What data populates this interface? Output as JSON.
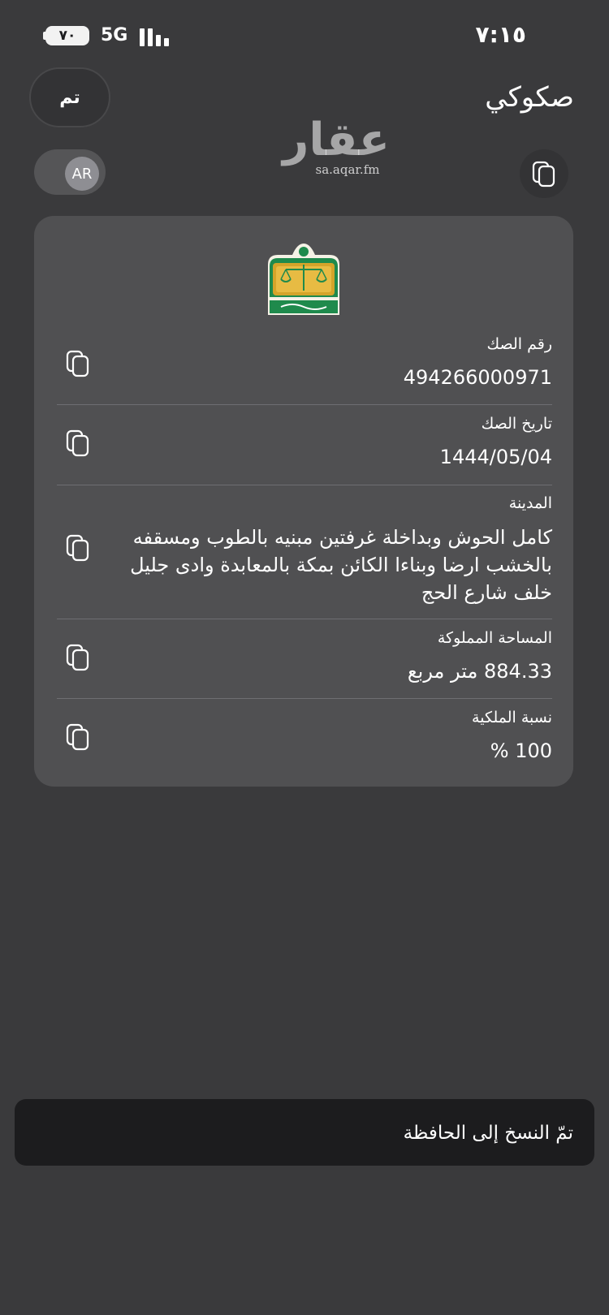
{
  "status_bar": {
    "time": "٧:١٥",
    "battery": "٧٠",
    "network": "5G"
  },
  "header": {
    "done_label": "تم",
    "title": "صكوكي",
    "language_label": "AR"
  },
  "watermark": {
    "text": "عقار",
    "url": "sa.aqar.fm"
  },
  "deed": {
    "fields": [
      {
        "label": "رقم الصك",
        "value": "494266000971"
      },
      {
        "label": "تاريخ الصك",
        "value": "1444/05/04"
      },
      {
        "label": "المدينة",
        "value": "كامل الحوش وبداخلة غرفتين مبنيه بالطوب ومسقفه بالخشب ارضا وبناءا الكائن بمكة بالمعابدة وادى جليل خلف شارع الحج"
      },
      {
        "label": "المساحة المملوكة",
        "value": "884.33 متر مربع"
      },
      {
        "label": "نسبة الملكية",
        "value": "100 %"
      }
    ]
  },
  "toast": {
    "message": "تمّ النسخ إلى الحافظة"
  },
  "colors": {
    "background": "#3a3a3c",
    "card": "#505052",
    "toast": "#1c1c1e",
    "emblem_green": "#1f8a4c",
    "emblem_gold": "#d4a42a"
  },
  "icons": {
    "copy": "copy-icon",
    "emblem": "ministry-of-justice-emblem"
  }
}
